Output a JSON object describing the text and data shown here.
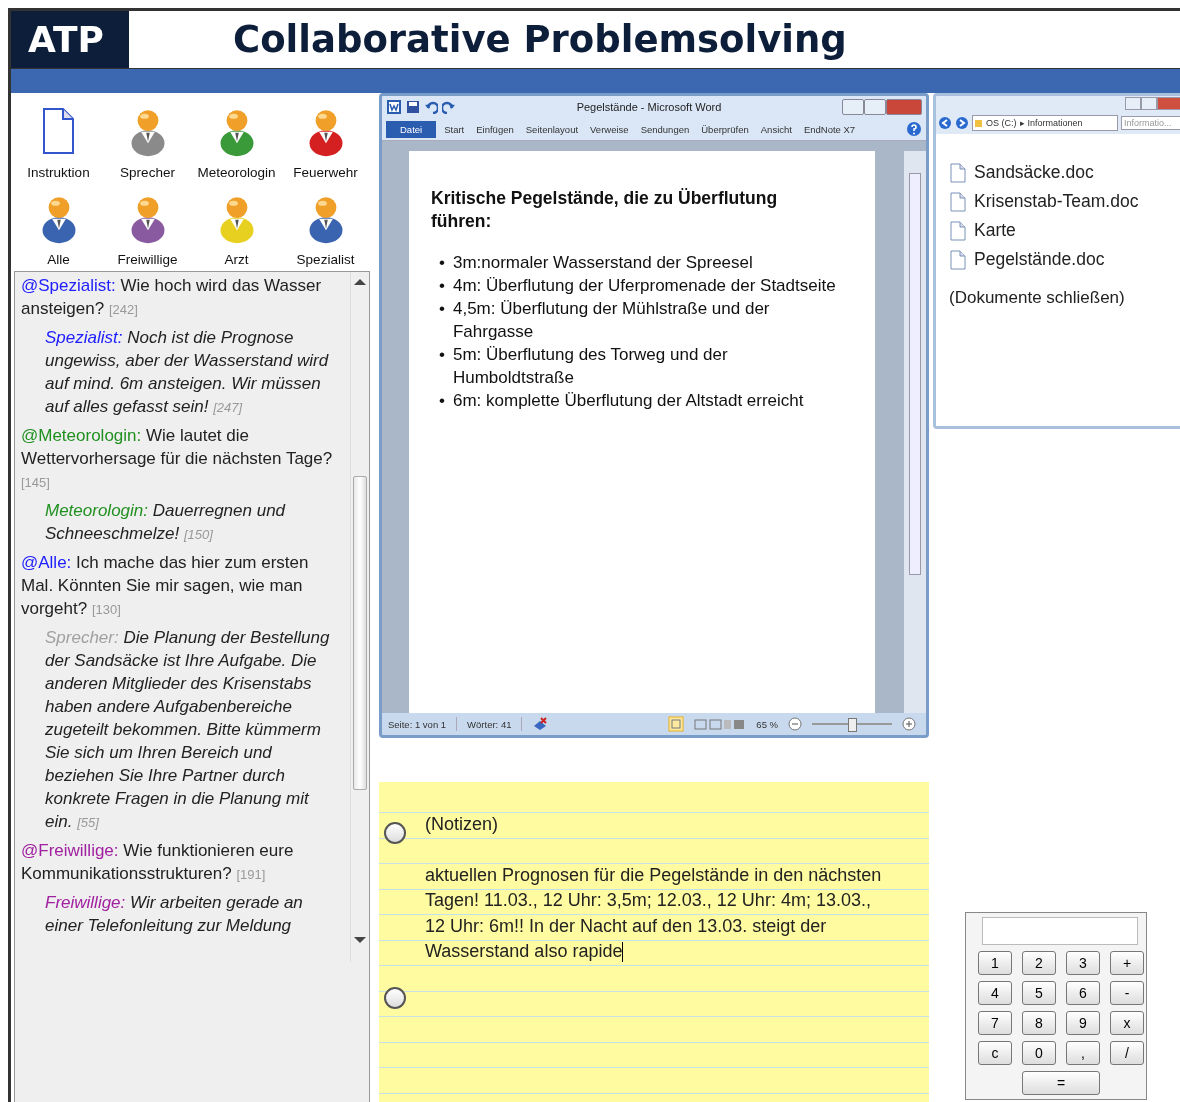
{
  "header": {
    "logo": "ATP",
    "title": "Collaborative Problemsolving"
  },
  "roles": [
    {
      "label": "Instruktion",
      "kind": "document"
    },
    {
      "label": "Sprecher",
      "kind": "person",
      "color": "#8a8a8a"
    },
    {
      "label": "Meteorologin",
      "kind": "person",
      "color": "#3a9a3a"
    },
    {
      "label": "Feuerwehr",
      "kind": "person",
      "color": "#d42020"
    },
    {
      "label": "Alle",
      "kind": "person",
      "color": "#3a63b0"
    },
    {
      "label": "Freiwillige",
      "kind": "person",
      "color": "#8a5aa0"
    },
    {
      "label": "Arzt",
      "kind": "person",
      "color": "#e8d020"
    },
    {
      "label": "Spezialist",
      "kind": "person",
      "color": "#3a63b0"
    }
  ],
  "chat": [
    {
      "kind": "question",
      "role": "@Spezialist:",
      "color": "#2020ff",
      "text": "Wie hoch wird das Wasser ansteigen?",
      "count": "[242]"
    },
    {
      "kind": "answer",
      "role": "Spezialist:",
      "color": "#2020ff",
      "text": "Noch ist die Prognose ungewiss, aber der Wasserstand wird auf mind. 6m ansteigen. Wir müssen auf alles gefasst sein!",
      "count": "[247]"
    },
    {
      "kind": "question",
      "role": "@Meteorologin:",
      "color": "#209020",
      "text": "Wie lautet die Wettervorhersage für die nächsten Tage?",
      "count": "[145]"
    },
    {
      "kind": "answer",
      "role": "Meteorologin:",
      "color": "#209020",
      "text": "Dauerregnen und Schneeschmelze!",
      "count": "[150]"
    },
    {
      "kind": "question",
      "role": "@Alle:",
      "color": "#2020ff",
      "text": "Ich mache das hier zum ersten Mal. Könnten Sie mir sagen, wie man vorgeht?",
      "count": "[130]"
    },
    {
      "kind": "answer",
      "role": "Sprecher:",
      "color": "#a0a0a0",
      "text": "Die Planung der Bestellung der Sandsäcke ist Ihre Aufgabe. Die anderen Mitglieder des Krisenstabs haben andere Aufgabenbereiche zugeteilt bekommen. Bitte kümmerm Sie sich um Ihren Bereich und beziehen Sie Ihre Partner durch konkrete Fragen in die Planung mit ein.",
      "count": "[55]"
    },
    {
      "kind": "question",
      "role": "@Freiwillige:",
      "color": "#a020a0",
      "text": "Wie funktionieren eure Kommunikationsstrukturen?",
      "count": "[191]"
    },
    {
      "kind": "answer",
      "role": "Freiwillige:",
      "color": "#a020a0",
      "text": "Wir arbeiten gerade an einer Telefonleitung zur Meldung"
    }
  ],
  "word": {
    "title": "Pegelstände  -  Microsoft Word",
    "tabs": [
      {
        "label": "Datei",
        "selected": true
      },
      {
        "label": "Start",
        "selected": false
      },
      {
        "label": "Einfügen",
        "selected": false
      },
      {
        "label": "Seitenlayout",
        "selected": false
      },
      {
        "label": "Verweise",
        "selected": false
      },
      {
        "label": "Sendungen",
        "selected": false
      },
      {
        "label": "Überprüfen",
        "selected": false
      },
      {
        "label": "Ansicht",
        "selected": false
      },
      {
        "label": "EndNote X7",
        "selected": false
      }
    ],
    "heading": "Kritische Pegelstände, die zu Überflutung führen:",
    "bullet_marker": "•",
    "bullets": [
      "3m:normaler Wasserstand der Spreesel",
      "4m: Überflutung der Uferpromenade der Stadtseite",
      "4,5m: Überflutung der Mühlstraße und der Fahrgasse",
      "5m: Überflutung des Torweg und der Humboldtstraße",
      "6m: komplette Überflutung der Altstadt erreicht"
    ],
    "page": "Seite: 1 von 1",
    "words": "Wörter: 41",
    "zoom": "65 %",
    "zoom_slider": {
      "level": 0.5
    }
  },
  "explorer": {
    "path": [
      "OS (C:)",
      "Informationen"
    ],
    "path_separator": "▸",
    "search": {
      "placeholder": "Informatio..."
    },
    "files": [
      {
        "name": "Sandsäcke.doc",
        "kind": "file"
      },
      {
        "name": "Krisenstab-Team.doc",
        "kind": "file"
      },
      {
        "name": "Karte",
        "kind": "file"
      },
      {
        "name": "Pegelstände.doc",
        "kind": "file"
      },
      {
        "name": "(Dokumente schließen)",
        "kind": "action"
      }
    ]
  },
  "notes": {
    "radios": [
      {
        "selected": false
      },
      {
        "selected": false
      }
    ],
    "title": "(Notizen)",
    "text": "aktuellen Prognosen für die Pegelstände in den nächsten Tagen! 11.03., 12 Uhr: 3,5m; 12.03., 12 Uhr: 4m; 13.03., 12 Uhr: 6m!! In der Nacht auf den 13.03. steigt der Wasserstand also rapide"
  },
  "calculator": {
    "keys": [
      "1",
      "2",
      "3",
      "+",
      "4",
      "5",
      "6",
      "-",
      "7",
      "8",
      "9",
      "x",
      "c",
      "0",
      ",",
      "/",
      "="
    ]
  }
}
